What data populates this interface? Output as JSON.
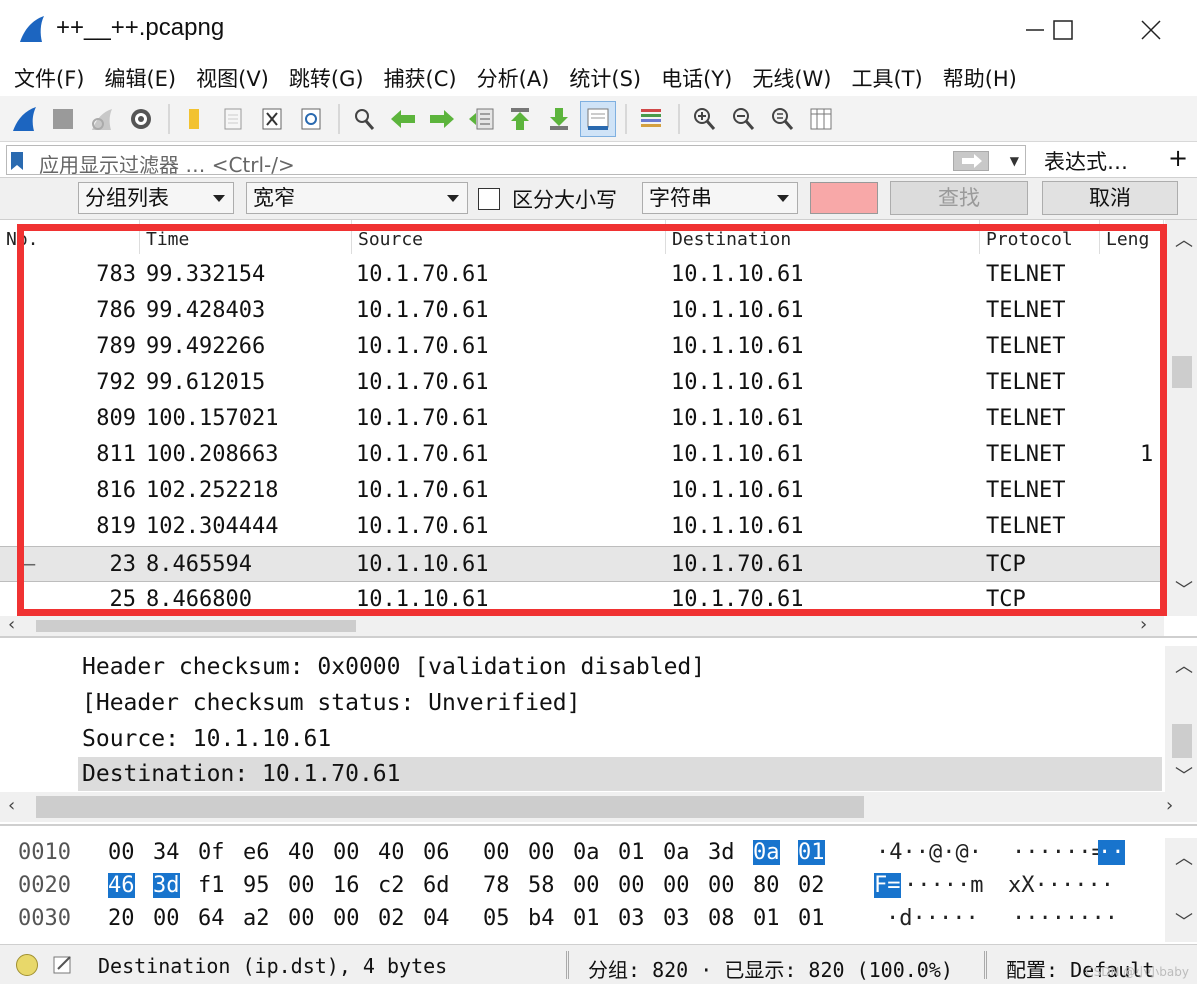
{
  "window": {
    "title": "++__++.pcapng",
    "minimize": "minimize",
    "maximize": "maximize",
    "close": "close"
  },
  "menu": [
    "文件(F)",
    "编辑(E)",
    "视图(V)",
    "跳转(G)",
    "捕获(C)",
    "分析(A)",
    "统计(S)",
    "电话(Y)",
    "无线(W)",
    "工具(T)",
    "帮助(H)"
  ],
  "toolbar": {
    "icons": [
      "shark-fin-start-icon",
      "stop-icon",
      "restart-icon",
      "options-gear-icon",
      "open-folder-icon",
      "file-icon",
      "close-file-icon",
      "reload-icon",
      "find-icon",
      "back-arrow-icon",
      "forward-arrow-icon",
      "goto-packet-icon",
      "first-packet-icon",
      "last-packet-icon",
      "autoscroll-icon",
      "colorize-icon",
      "zoom-in-icon",
      "zoom-out-icon",
      "zoom-normal-icon",
      "resize-columns-icon"
    ]
  },
  "filter": {
    "placeholder": "应用显示过滤器 … <Ctrl-/>",
    "expression_label": "表达式…",
    "add_label": "+"
  },
  "search": {
    "scope": "分组列表",
    "charset": "宽窄",
    "case_label": "区分大小写",
    "type": "字符串",
    "find_label": "查找",
    "cancel_label": "取消"
  },
  "packet_list": {
    "columns": [
      "No.",
      "Time",
      "Source",
      "Destination",
      "Protocol",
      "Leng"
    ],
    "rows": [
      {
        "no": "783",
        "time": "99.332154",
        "src": "10.1.70.61",
        "dst": "10.1.10.61",
        "proto": "TELNET",
        "len": ""
      },
      {
        "no": "786",
        "time": "99.428403",
        "src": "10.1.70.61",
        "dst": "10.1.10.61",
        "proto": "TELNET",
        "len": ""
      },
      {
        "no": "789",
        "time": "99.492266",
        "src": "10.1.70.61",
        "dst": "10.1.10.61",
        "proto": "TELNET",
        "len": ""
      },
      {
        "no": "792",
        "time": "99.612015",
        "src": "10.1.70.61",
        "dst": "10.1.10.61",
        "proto": "TELNET",
        "len": ""
      },
      {
        "no": "809",
        "time": "100.157021",
        "src": "10.1.70.61",
        "dst": "10.1.10.61",
        "proto": "TELNET",
        "len": ""
      },
      {
        "no": "811",
        "time": "100.208663",
        "src": "10.1.70.61",
        "dst": "10.1.10.61",
        "proto": "TELNET",
        "len": "1"
      },
      {
        "no": "816",
        "time": "102.252218",
        "src": "10.1.70.61",
        "dst": "10.1.10.61",
        "proto": "TELNET",
        "len": ""
      },
      {
        "no": "819",
        "time": "102.304444",
        "src": "10.1.70.61",
        "dst": "10.1.10.61",
        "proto": "TELNET",
        "len": ""
      },
      {
        "no": "23",
        "time": "8.465594",
        "src": "10.1.10.61",
        "dst": "10.1.70.61",
        "proto": "TCP",
        "len": ""
      },
      {
        "no": "25",
        "time": "8.466800",
        "src": "10.1.10.61",
        "dst": "10.1.70.61",
        "proto": "TCP",
        "len": ""
      }
    ],
    "selected_marker": "—"
  },
  "details": {
    "lines": [
      "Header checksum: 0x0000 [validation disabled]",
      "[Header checksum status: Unverified]",
      "Source: 10.1.10.61",
      "Destination: 10.1.70.61"
    ]
  },
  "bytes": {
    "rows": [
      {
        "offset": "0010",
        "hex": [
          "00",
          "34",
          "0f",
          "e6",
          "40",
          "00",
          "40",
          "06",
          "00",
          "00",
          "0a",
          "01",
          "0a",
          "3d",
          "0a",
          "01"
        ],
        "ascii": "·4··@·@· ······=··",
        "ascii_plain": "·4··@·@·",
        "ascii_plain2": "······=",
        "ascii_sel": "··"
      },
      {
        "offset": "0020",
        "hex": [
          "46",
          "3d",
          "f1",
          "95",
          "00",
          "16",
          "c2",
          "6d",
          "78",
          "58",
          "00",
          "00",
          "00",
          "00",
          "80",
          "02"
        ],
        "ascii_sel": "F=",
        "ascii_plain": "·····m",
        "ascii_plain2": "xX······"
      },
      {
        "offset": "0030",
        "hex": [
          "20",
          "00",
          "64",
          "a2",
          "00",
          "00",
          "02",
          "04",
          "05",
          "b4",
          "01",
          "03",
          "03",
          "08",
          "01",
          "01"
        ],
        "ascii_plain": "·d·····",
        "ascii_plain2": "········"
      }
    ]
  },
  "status": {
    "field_info": "Destination (ip.dst), 4 bytes",
    "packets_info": "分组: 820 · 已显示: 820 (100.0%)",
    "profile_info": "配置: Default",
    "watermark": "CSDN @小小baby"
  },
  "colors": {
    "highlight_border": "#f03232",
    "selection_blue": "#1874cd",
    "search_field": "#f8a8a8"
  }
}
